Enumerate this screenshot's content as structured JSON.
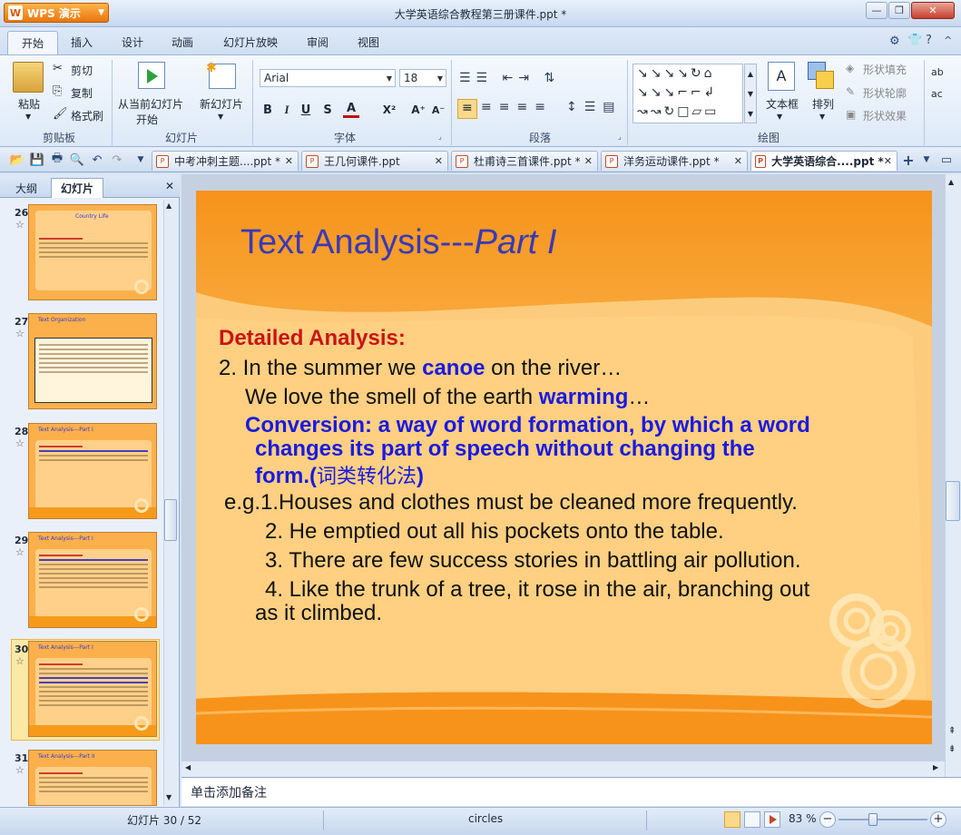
{
  "app": {
    "name": "WPS 演示",
    "document_title": "大学英语综合教程第三册课件.ppt *"
  },
  "window_buttons": {
    "minimize": "—",
    "restore": "❐",
    "close": "✕"
  },
  "menu": {
    "tabs": [
      "开始",
      "插入",
      "设计",
      "动画",
      "幻灯片放映",
      "审阅",
      "视图"
    ],
    "active": "开始"
  },
  "ribbon": {
    "clipboard": {
      "paste": "粘贴",
      "cut": "剪切",
      "copy": "复制",
      "format_painter": "格式刷",
      "group": "剪贴板"
    },
    "slides": {
      "from_current": "从当前幻灯片",
      "from_current_2": "开始",
      "new_slide": "新幻灯片",
      "group": "幻灯片"
    },
    "font": {
      "name": "Arial",
      "size": "18",
      "bold": "B",
      "italic": "I",
      "underline": "U",
      "strike": "S",
      "color": "A",
      "superscript": "X²",
      "grow": "A⁺",
      "shrink": "A⁻",
      "group": "字体"
    },
    "paragraph": {
      "group": "段落"
    },
    "drawing": {
      "textbox": "文本框",
      "arrange": "排列",
      "fill": "形状填充",
      "outline": "形状轮廓",
      "effect": "形状效果",
      "group": "绘图"
    },
    "partial_right": "ab ac"
  },
  "doc_tabs": [
    {
      "label": "中考冲刺主题....ppt *"
    },
    {
      "label": "王几何课件.ppt"
    },
    {
      "label": "杜甫诗三首课件.ppt *"
    },
    {
      "label": "洋务运动课件.ppt *"
    },
    {
      "label": "大学英语综合....ppt *",
      "active": true
    }
  ],
  "left_pane": {
    "tabs": [
      "大纲",
      "幻灯片"
    ],
    "active_tab": "幻灯片",
    "close": "✕",
    "thumbnails": [
      {
        "num": "26",
        "title": "Country Life"
      },
      {
        "num": "27",
        "title": "Text Organization"
      },
      {
        "num": "28",
        "title": "Text Analysis---Part I"
      },
      {
        "num": "29",
        "title": "Text Analysis---Part I"
      },
      {
        "num": "30",
        "title": "Text Analysis---Part I",
        "selected": true
      },
      {
        "num": "31",
        "title": "Text Analysis---Part II"
      }
    ]
  },
  "slide": {
    "title_plain": "Text Analysis---",
    "title_italic": "Part I",
    "heading": "Detailed Analysis:",
    "line1_pre": "2. In the summer we ",
    "line1_kw": "canoe",
    "line1_post": " on the river…",
    "line2_pre": "We love the smell of the earth ",
    "line2_kw": "warming",
    "line2_post": "…",
    "conv1": "Conversion: a way of word formation, by which a word",
    "conv2": "changes its part of speech without changing the",
    "conv3_en": "form.(",
    "conv3_cn": "词类转化法",
    "conv3_end": ")",
    "eg1": "e.g.1.Houses and clothes must be cleaned more frequently.",
    "eg2": "2. He emptied out all his pockets onto the table.",
    "eg3": "3. There are few success stories in battling air pollution.",
    "eg4a": "4. Like the trunk of a tree, it rose in the air, branching out",
    "eg4b": "as it  climbed."
  },
  "notes_placeholder": "单击添加备注",
  "status": {
    "slide_counter": "幻灯片 30 / 52",
    "theme": "circles",
    "zoom": "83 %"
  },
  "colors": {
    "accent_orange": "#f79f1f",
    "slide_body": "#ffc97a",
    "title_blue": "#3a3ab8",
    "keyword_blue": "#1a1ae0",
    "heading_red": "#c81414"
  }
}
